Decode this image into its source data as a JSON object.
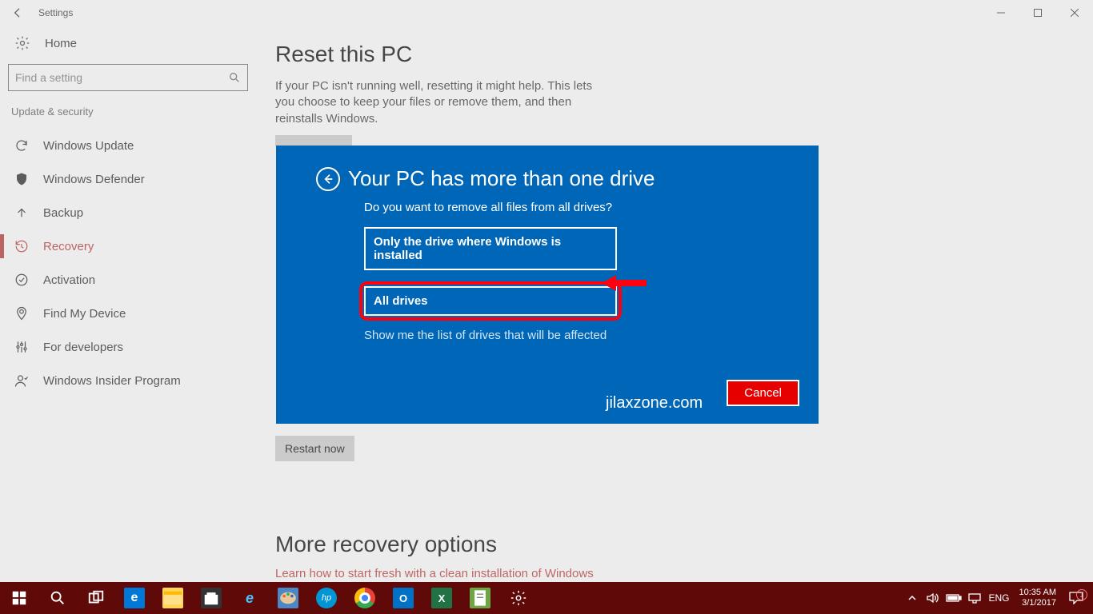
{
  "window": {
    "title": "Settings"
  },
  "sidebar": {
    "home": "Home",
    "search_placeholder": "Find a setting",
    "group": "Update & security",
    "items": [
      {
        "label": "Windows Update"
      },
      {
        "label": "Windows Defender"
      },
      {
        "label": "Backup"
      },
      {
        "label": "Recovery"
      },
      {
        "label": "Activation"
      },
      {
        "label": "Find My Device"
      },
      {
        "label": "For developers"
      },
      {
        "label": "Windows Insider Program"
      }
    ]
  },
  "main": {
    "reset_heading": "Reset this PC",
    "reset_desc": "If your PC isn't running well, resetting it might help. This lets you choose to keep your files or remove them, and then reinstalls Windows.",
    "restart_btn": "Restart now",
    "more_heading": "More recovery options",
    "more_link": "Learn how to start fresh with a clean installation of Windows"
  },
  "dialog": {
    "title": "Your PC has more than one drive",
    "question": "Do you want to remove all files from all drives?",
    "opt1": "Only the drive where Windows is installed",
    "opt2": "All drives",
    "showlist": "Show me the list of drives that will be affected",
    "cancel": "Cancel",
    "watermark": "jilaxzone.com"
  },
  "taskbar": {
    "lang": "ENG",
    "time": "10:35 AM",
    "date": "3/1/2017",
    "notif_count": "1"
  }
}
